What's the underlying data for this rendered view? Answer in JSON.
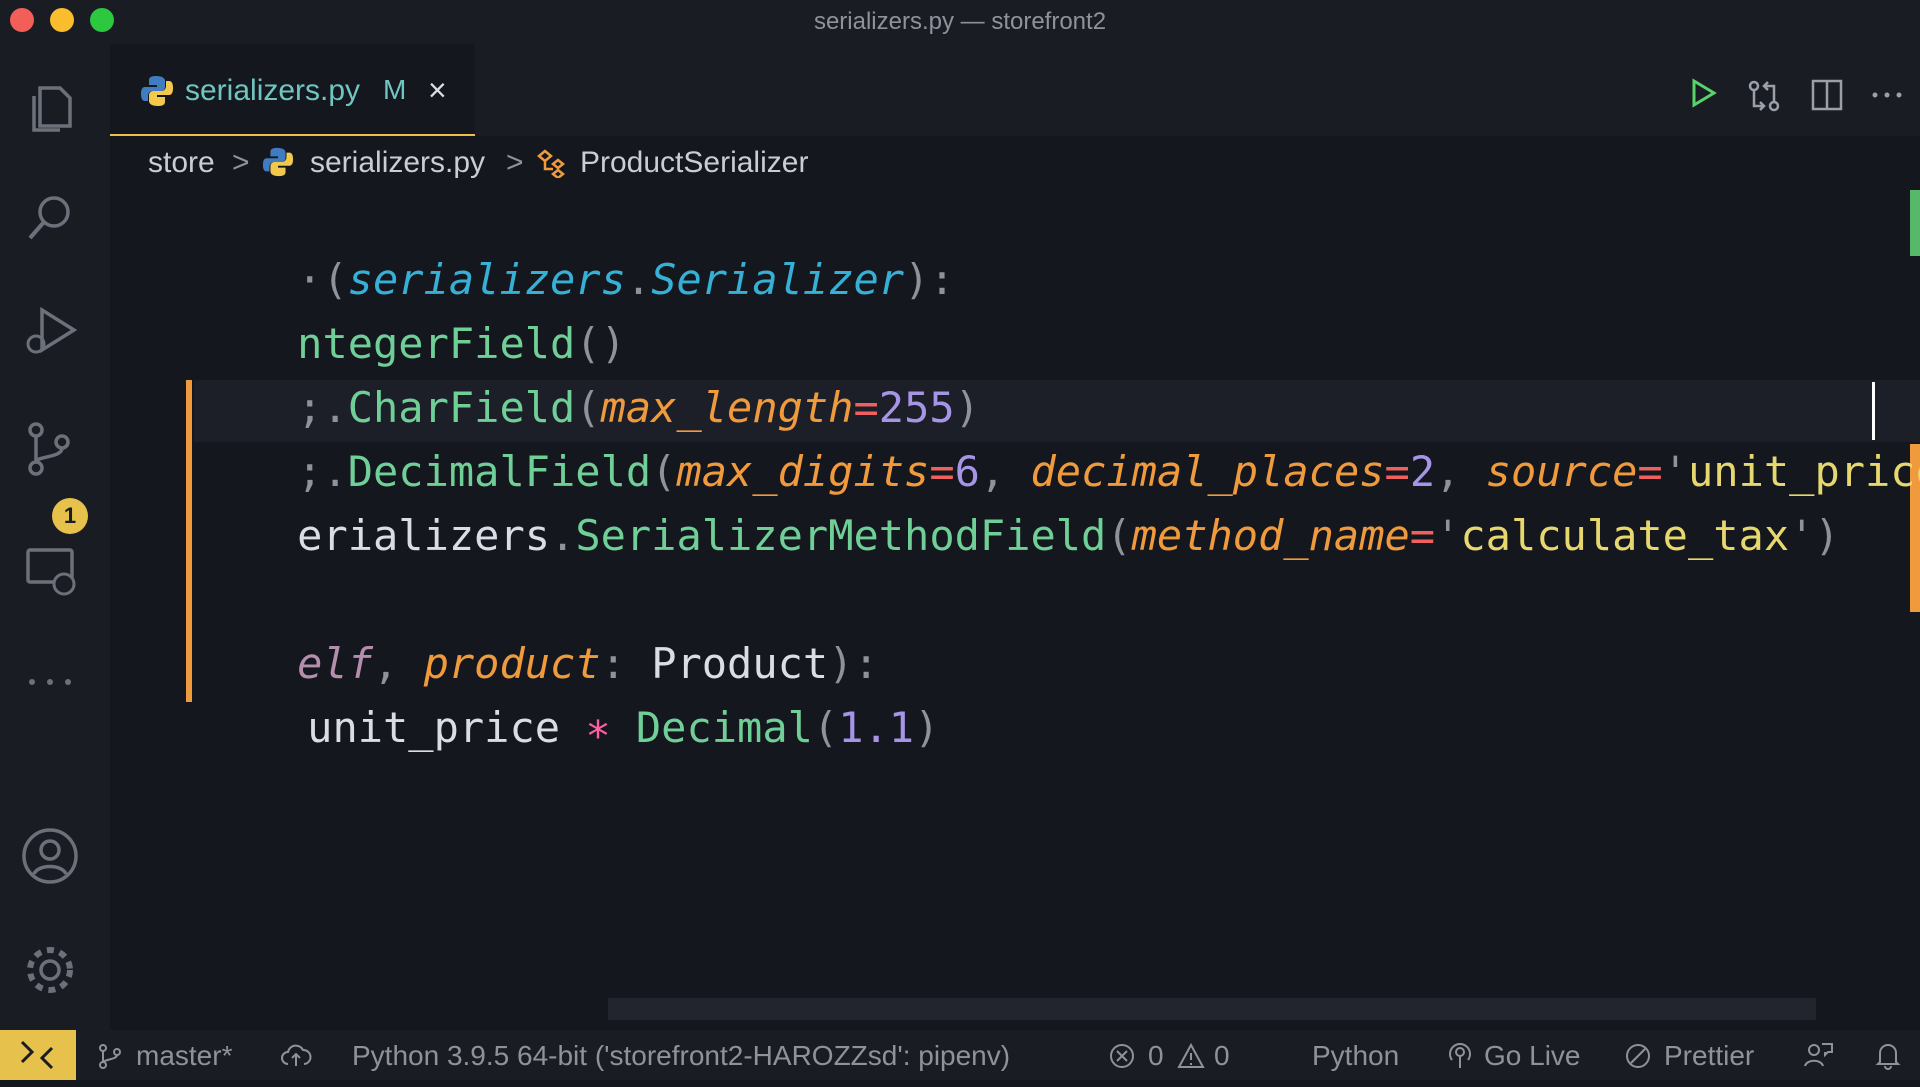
{
  "window": {
    "title": "serializers.py — storefront2"
  },
  "colors": {
    "accent": "#e6c14b",
    "modified": "#f09a3e",
    "added": "#58b86a",
    "run": "#58d26a"
  },
  "activity_bar": {
    "items": [
      "explorer-icon",
      "search-icon",
      "run-debug-icon",
      "source-control-icon",
      "remote-explorer-icon",
      "more-icon",
      "account-icon",
      "gear-icon"
    ],
    "source_control_badge": "1"
  },
  "tab": {
    "icon": "python-icon",
    "label": "serializers.py",
    "status": "M",
    "close": "×"
  },
  "tab_actions": [
    "run-icon",
    "compare-changes-icon",
    "split-editor-icon",
    "more-actions-icon"
  ],
  "breadcrumb": {
    "folder": "store",
    "file": "serializers.py",
    "symbol": "ProductSerializer",
    "sep": ">"
  },
  "code": {
    "l1": {
      "a": "·(",
      "b": "serializers",
      "c": ".",
      "d": "Serializer",
      "e": "):"
    },
    "l2": {
      "a": "ntegerField",
      "b": "()"
    },
    "l3": {
      "a": ";.",
      "b": "CharField",
      "c": "(",
      "d": "max_length",
      "e": "=",
      "f": "255",
      "g": ")"
    },
    "l4": {
      "a": ";.",
      "b": "DecimalField",
      "c": "(",
      "d": "max_digits",
      "e": "=",
      "f": "6",
      "g": ", ",
      "h": "decimal_places",
      "i": "=",
      "j": "2",
      "k": ", ",
      "l": "source",
      "m": "=",
      "n": "'",
      "o": "unit_price",
      "p": "'",
      "q": ")"
    },
    "l5": {
      "a": "erializers",
      "b": ".",
      "c": "SerializerMethodField",
      "d": "(",
      "e": "method_name",
      "f": "=",
      "g": "'",
      "h": "calculate_tax",
      "i": "'",
      "j": ")"
    },
    "l7": {
      "a": "elf",
      "b": ", ",
      "c": "product",
      "d": ": ",
      "e": "Product",
      "f": "):"
    },
    "l8": {
      "a": "unit_price",
      "b": " ∗ ",
      "c": "Decimal",
      "d": "(",
      "e": "1.1",
      "f": ")"
    }
  },
  "status_bar": {
    "branch": "master*",
    "interpreter": "Python 3.9.5 64-bit ('storefront2-HAROZZsd': pipenv)",
    "errors": "0",
    "warnings": "0",
    "language": "Python",
    "go_live": "Go Live",
    "prettier": "Prettier"
  }
}
